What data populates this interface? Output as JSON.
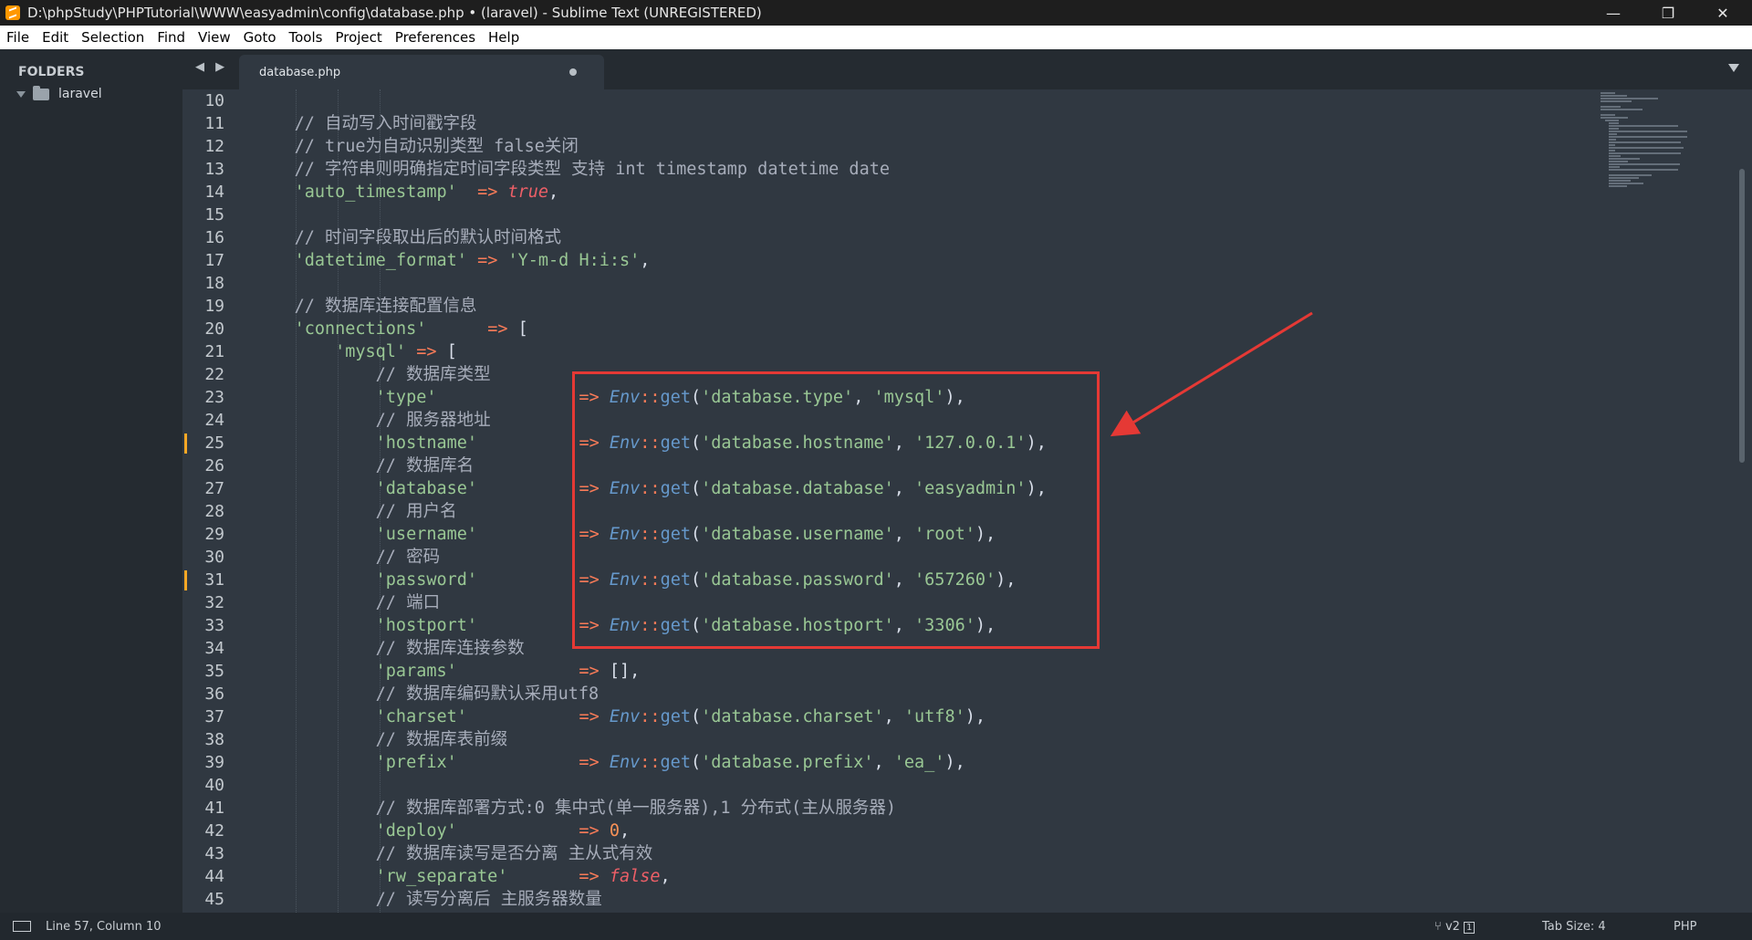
{
  "window": {
    "title": "D:\\phpStudy\\PHPTutorial\\WWW\\easyadmin\\config\\database.php • (laravel) - Sublime Text (UNREGISTERED)",
    "minimize_glyph": "—",
    "maximize_glyph": "❐",
    "close_glyph": "✕"
  },
  "menu": [
    "File",
    "Edit",
    "Selection",
    "Find",
    "View",
    "Goto",
    "Tools",
    "Project",
    "Preferences",
    "Help"
  ],
  "sidebar": {
    "header": "FOLDERS",
    "folder": "laravel"
  },
  "tabs": {
    "nav_arrows": "◀ ▶",
    "active_tab": "database.php"
  },
  "editor": {
    "line_numbers": [
      "10",
      "11",
      "12",
      "13",
      "14",
      "15",
      "16",
      "17",
      "18",
      "19",
      "20",
      "21",
      "22",
      "23",
      "24",
      "25",
      "26",
      "27",
      "28",
      "29",
      "30",
      "31",
      "32",
      "33",
      "34",
      "35",
      "36",
      "37",
      "38",
      "39",
      "40",
      "41",
      "42",
      "43",
      "44",
      "45"
    ],
    "modified_lines": [
      "25",
      "31"
    ],
    "code": [
      "",
      "    // 自动写入时间戳字段",
      "    // true为自动识别类型 false关闭",
      "    // 字符串则明确指定时间字段类型 支持 int timestamp datetime date",
      "    'auto_timestamp'  => true,",
      "",
      "    // 时间字段取出后的默认时间格式",
      "    'datetime_format' => 'Y-m-d H:i:s',",
      "",
      "    // 数据库连接配置信息",
      "    'connections'      => [",
      "        'mysql' => [",
      "            // 数据库类型",
      "            'type'              => Env::get('database.type', 'mysql'),",
      "            // 服务器地址",
      "            'hostname'          => Env::get('database.hostname', '127.0.0.1'),",
      "            // 数据库名",
      "            'database'          => Env::get('database.database', 'easyadmin'),",
      "            // 用户名",
      "            'username'          => Env::get('database.username', 'root'),",
      "            // 密码",
      "            'password'          => Env::get('database.password', '657260'),",
      "            // 端口",
      "            'hostport'          => Env::get('database.hostport', '3306'),",
      "            // 数据库连接参数",
      "            'params'            => [],",
      "            // 数据库编码默认采用utf8",
      "            'charset'           => Env::get('database.charset', 'utf8'),",
      "            // 数据库表前缀",
      "            'prefix'            => Env::get('database.prefix', 'ea_'),",
      "",
      "            // 数据库部署方式:0 集中式(单一服务器),1 分布式(主从服务器)",
      "            'deploy'            => 0,",
      "            // 数据库读写是否分离 主从式有效",
      "            'rw_separate'       => false,",
      "            // 读写分离后 主服务器数量"
    ]
  },
  "status": {
    "position": "Line 57, Column 10",
    "git": "v2",
    "git_count": "1",
    "tab_size": "Tab Size: 4",
    "syntax": "PHP"
  },
  "colors": {
    "background": "#303841",
    "comment": "#a7adba",
    "string": "#99c794",
    "operator": "#f97b58",
    "class": "#6699cc",
    "keyword": "#ec5f67",
    "number": "#f99157",
    "annotation": "#e53935",
    "modified_marker": "#f9a825"
  }
}
